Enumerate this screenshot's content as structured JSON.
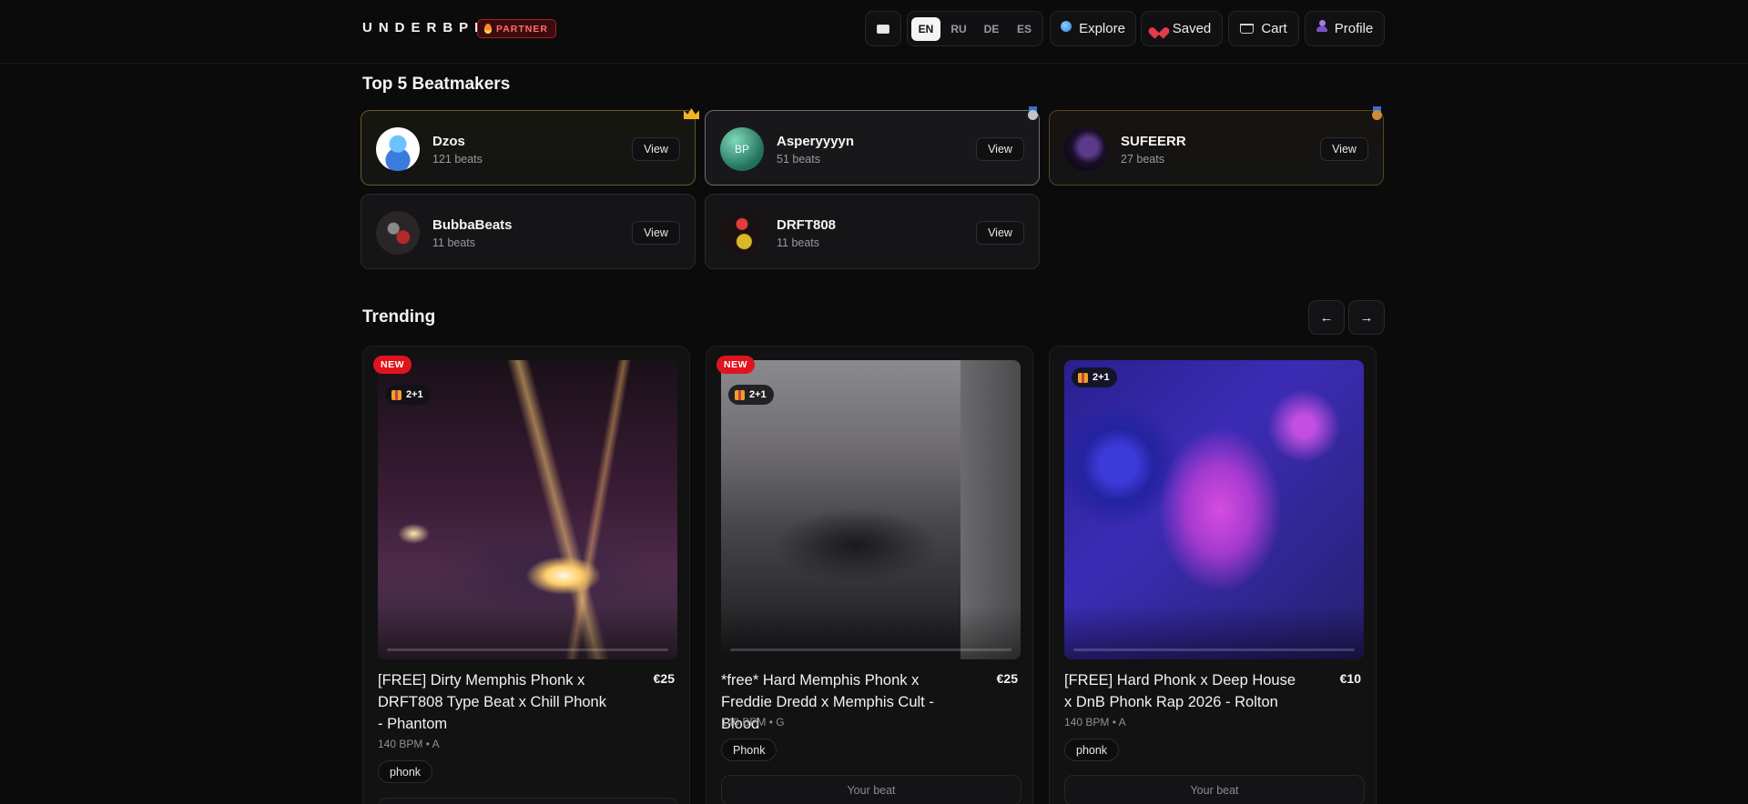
{
  "header": {
    "logo": "UNDERBPM",
    "partner_badge": "PARTNER",
    "languages": [
      "EN",
      "RU",
      "DE",
      "ES"
    ],
    "active_language": "EN",
    "nav": {
      "explore": "Explore",
      "saved": "Saved",
      "cart": "Cart",
      "profile": "Profile"
    },
    "icons": [
      "mail-icon",
      "search-icon",
      "heart-icon",
      "cart-icon",
      "user-icon"
    ]
  },
  "top_beatmakers": {
    "title": "Top 5 Beatmakers",
    "view_label": "View",
    "items": [
      {
        "name": "Dzos",
        "beats": "121 beats",
        "rank_icon": "crown-icon"
      },
      {
        "name": "Asperyyyyn",
        "beats": "51 beats",
        "rank_icon": "silver-medal-icon",
        "avatar_initials": "BP"
      },
      {
        "name": "SUFEERR",
        "beats": "27 beats",
        "rank_icon": "bronze-medal-icon"
      },
      {
        "name": "BubbaBeats",
        "beats": "11 beats"
      },
      {
        "name": "DRFT808",
        "beats": "11 beats"
      }
    ]
  },
  "trending": {
    "title": "Trending",
    "prev_label": "←",
    "next_label": "→",
    "beats": [
      {
        "new_badge": "NEW",
        "gift_badge": "2+1",
        "title": "[FREE] Dirty Memphis Phonk x DRFT808 Type Beat x Chill Phonk - Phantom",
        "price": "€25",
        "meta": "140 BPM • A",
        "tag": "phonk",
        "progress": 0.0
      },
      {
        "new_badge": "NEW",
        "gift_badge": "2+1",
        "title": "*free* Hard Memphis Phonk x Freddie Dredd x Memphis Cult - Blood",
        "price": "€25",
        "meta": "140 BPM • G",
        "tag": "Phonk",
        "action": "Your beat",
        "progress": 0.0
      },
      {
        "gift_badge": "2+1",
        "title": "[FREE] Hard Phonk x Deep House x DnB Phonk Rap 2026 - Rolton",
        "price": "€10",
        "meta": "140 BPM • A",
        "tag": "phonk",
        "action": "Your beat",
        "progress": 0.0
      }
    ]
  }
}
